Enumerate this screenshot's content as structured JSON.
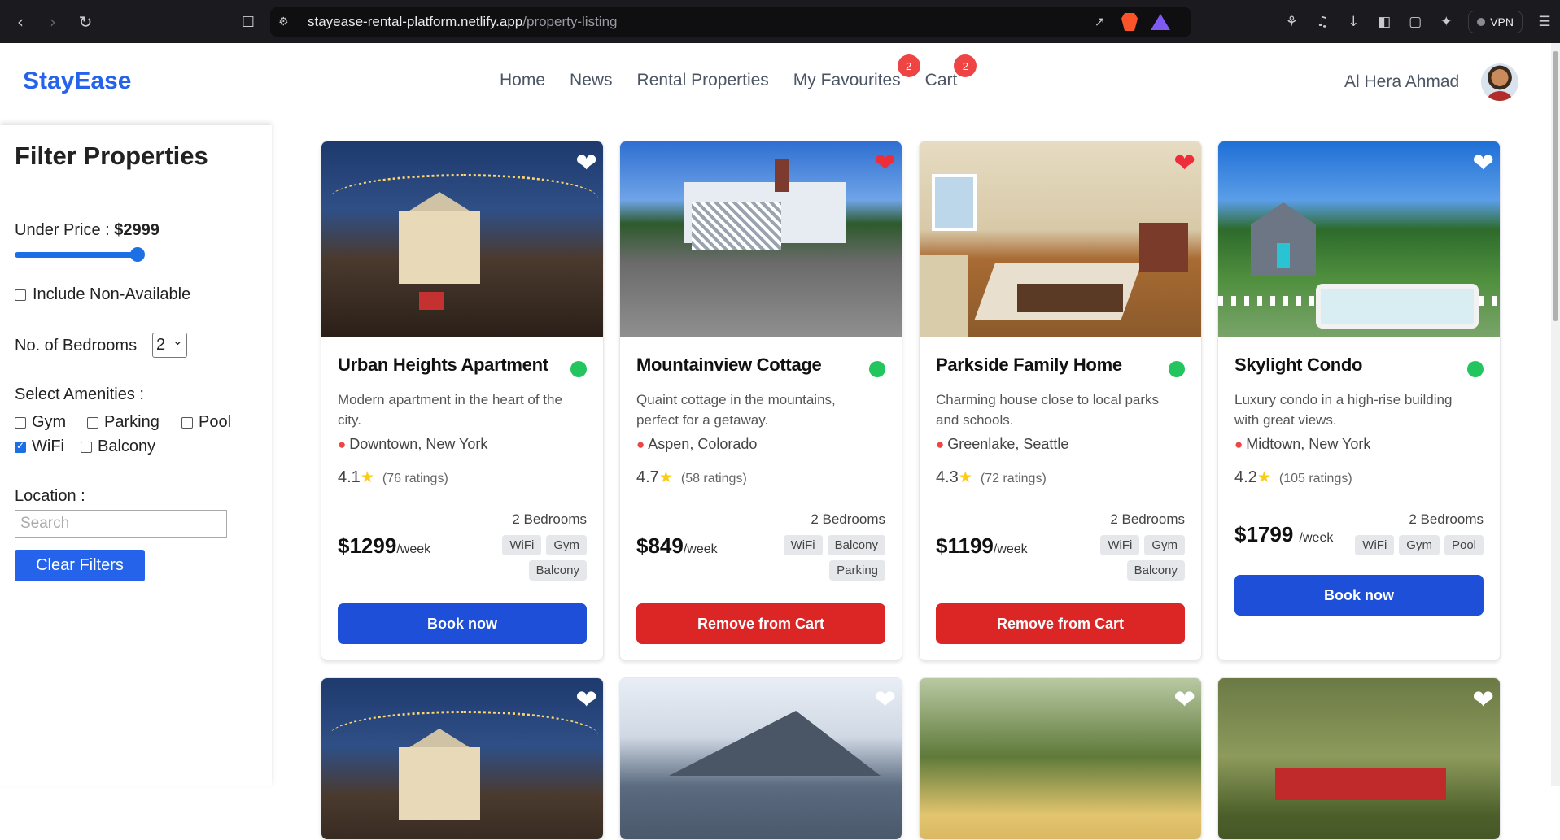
{
  "browser": {
    "url_domain": "stayease-rental-platform.netlify.app",
    "url_path": "/property-listing",
    "vpn_label": "VPN"
  },
  "header": {
    "logo": "StayEase",
    "nav": [
      {
        "label": "Home"
      },
      {
        "label": "News"
      },
      {
        "label": "Rental Properties"
      },
      {
        "label": "My Favourites",
        "badge": "2"
      },
      {
        "label": "Cart",
        "badge": "2"
      }
    ],
    "user_name": "Al Hera Ahmad"
  },
  "filters": {
    "title": "Filter Properties",
    "price_label": "Under Price : ",
    "price_value": "$2999",
    "price_slider_fraction": 1.0,
    "include_non_available": {
      "label": "Include Non-Available",
      "checked": false
    },
    "bedrooms_label": "No. of Bedrooms",
    "bedrooms_value": "2",
    "amenities_label": "Select Amenities :",
    "amenities": [
      {
        "label": "Gym",
        "checked": false
      },
      {
        "label": "Parking",
        "checked": false
      },
      {
        "label": "Pool",
        "checked": false
      },
      {
        "label": "WiFi",
        "checked": true
      },
      {
        "label": "Balcony",
        "checked": false
      }
    ],
    "location_label": "Location :",
    "location_placeholder": "Search",
    "clear_button": "Clear Filters"
  },
  "colors": {
    "brand": "#2563eb",
    "book_button": "#1d4fd8",
    "remove_button": "#dc2626",
    "available": "#22c55e",
    "favourite_heart": "#ef2d3a",
    "badge": "#ef4444"
  },
  "properties": [
    {
      "title": "Urban Heights Apartment",
      "description": "Modern apartment in the heart of the city.",
      "location": "Downtown, New York",
      "rating": "4.1",
      "ratings_count": "(76 ratings)",
      "price": "$1299",
      "unit": "/week",
      "bedrooms": "2 Bedrooms",
      "amenities": [
        "WiFi",
        "Gym",
        "Balcony"
      ],
      "button": "Book now",
      "favourite": false
    },
    {
      "title": "Mountainview Cottage",
      "description": "Quaint cottage in the mountains, perfect for a getaway.",
      "location": "Aspen, Colorado",
      "rating": "4.7",
      "ratings_count": "(58 ratings)",
      "price": "$849",
      "unit": "/week",
      "bedrooms": "2 Bedrooms",
      "amenities": [
        "WiFi",
        "Balcony",
        "Parking"
      ],
      "button": "Remove from Cart",
      "favourite": true
    },
    {
      "title": "Parkside Family Home",
      "description": "Charming house close to local parks and schools.",
      "location": "Greenlake, Seattle",
      "rating": "4.3",
      "ratings_count": "(72 ratings)",
      "price": "$1199",
      "unit": "/week",
      "bedrooms": "2 Bedrooms",
      "amenities": [
        "WiFi",
        "Gym",
        "Balcony"
      ],
      "button": "Remove from Cart",
      "favourite": true
    },
    {
      "title": "Skylight Condo",
      "description": "Luxury condo in a high-rise building with great views.",
      "location": "Midtown, New York",
      "rating": "4.2",
      "ratings_count": "(105 ratings)",
      "price": "$1799",
      "unit": "/week",
      "bedrooms": "2 Bedrooms",
      "amenities": [
        "WiFi",
        "Gym",
        "Pool"
      ],
      "button": "Book now",
      "favourite": false
    }
  ]
}
